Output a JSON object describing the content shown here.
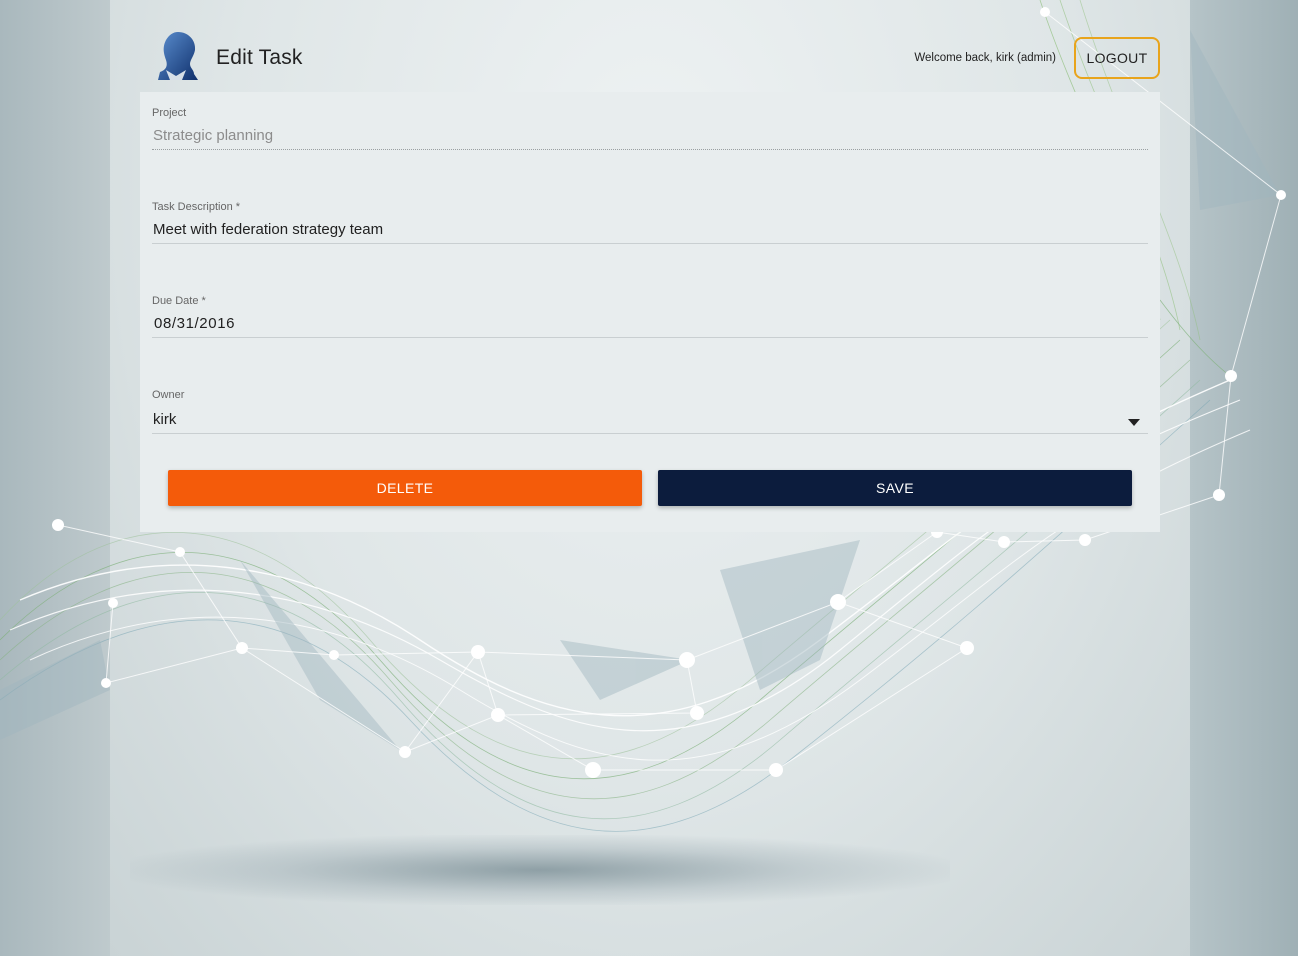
{
  "header": {
    "title": "Edit Task",
    "welcome": "Welcome back, kirk (admin)",
    "logout_label": "LOGOUT"
  },
  "form": {
    "project": {
      "label": "Project",
      "value": "Strategic planning"
    },
    "description": {
      "label": "Task Description *",
      "value": "Meet with federation strategy team"
    },
    "due_date": {
      "label": "Due Date *",
      "value": "08/31/2016"
    },
    "owner": {
      "label": "Owner",
      "value": "kirk"
    }
  },
  "actions": {
    "delete_label": "DELETE",
    "save_label": "SAVE"
  },
  "colors": {
    "delete": "#f45b0a",
    "save": "#0c1c3d",
    "logout_border": "#e8a41c"
  }
}
